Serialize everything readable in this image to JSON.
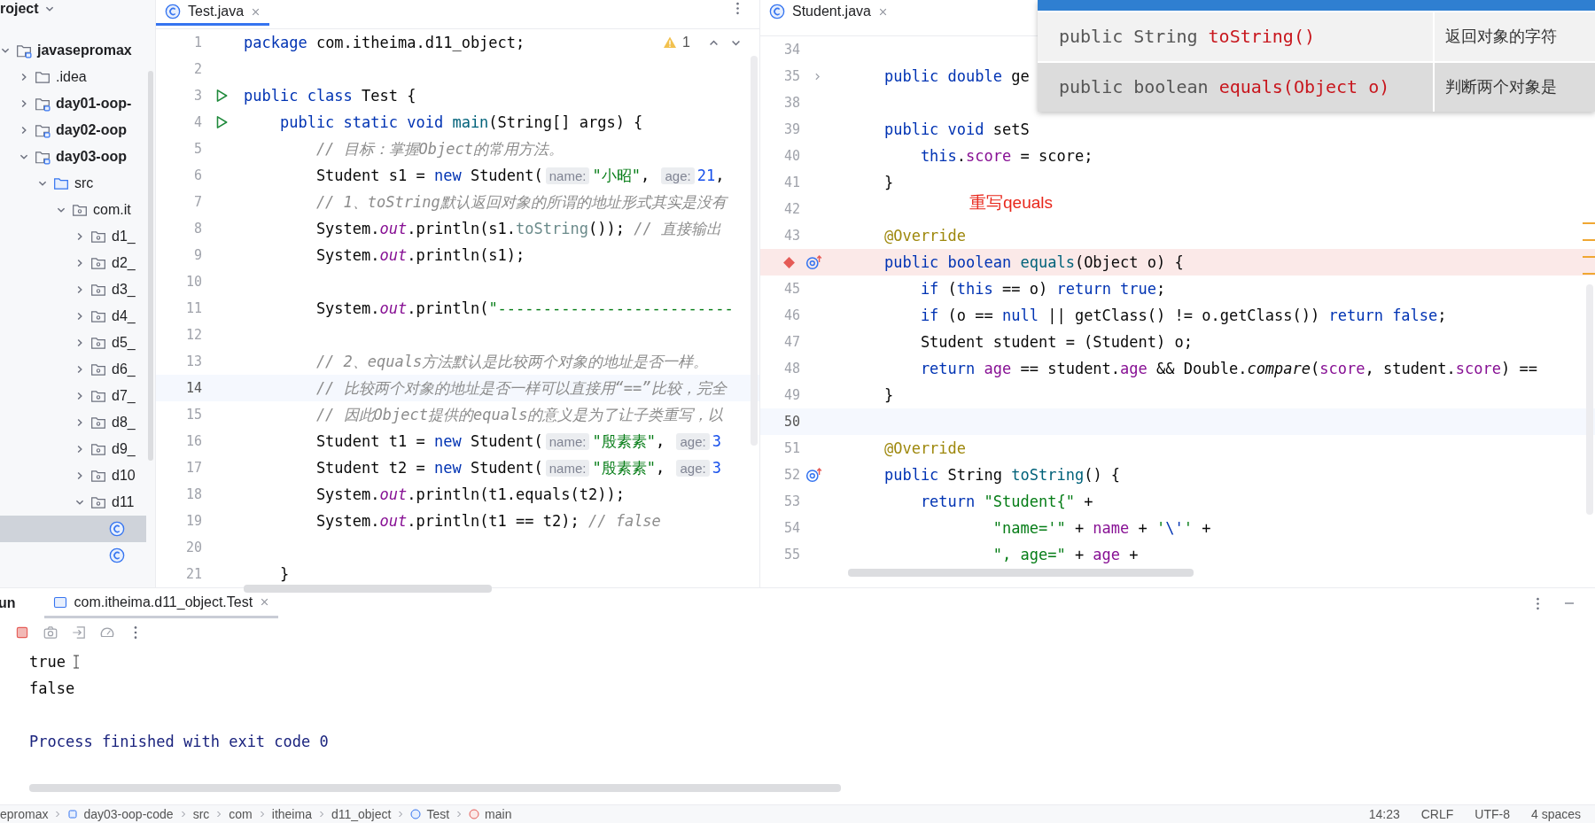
{
  "project_panel": {
    "title": "roject",
    "tree": [
      {
        "label": "javasepromax",
        "kind": "module",
        "expanded": true,
        "selected": false,
        "children": [
          {
            "label": ".idea",
            "kind": "folder",
            "expanded": false,
            "selected": false
          },
          {
            "label": "day01-oop-",
            "kind": "module",
            "expanded": false,
            "selected": false
          },
          {
            "label": "day02-oop",
            "kind": "module",
            "expanded": false,
            "selected": false
          },
          {
            "label": "day03-oop",
            "kind": "module",
            "expanded": true,
            "selected": false,
            "children": [
              {
                "label": "src",
                "kind": "source",
                "expanded": true,
                "selected": false,
                "children": [
                  {
                    "label": "com.it",
                    "kind": "package",
                    "expanded": true,
                    "selected": false,
                    "children": [
                      {
                        "label": "d1_",
                        "kind": "package",
                        "expanded": false,
                        "selected": false
                      },
                      {
                        "label": "d2_",
                        "kind": "package",
                        "expanded": false,
                        "selected": false
                      },
                      {
                        "label": "d3_",
                        "kind": "package",
                        "expanded": false,
                        "selected": false
                      },
                      {
                        "label": "d4_",
                        "kind": "package",
                        "expanded": false,
                        "selected": false
                      },
                      {
                        "label": "d5_",
                        "kind": "package",
                        "expanded": false,
                        "selected": false
                      },
                      {
                        "label": "d6_",
                        "kind": "package",
                        "expanded": false,
                        "selected": false
                      },
                      {
                        "label": "d7_",
                        "kind": "package",
                        "expanded": false,
                        "selected": false
                      },
                      {
                        "label": "d8_",
                        "kind": "package",
                        "expanded": false,
                        "selected": false
                      },
                      {
                        "label": "d9_",
                        "kind": "package",
                        "expanded": false,
                        "selected": false
                      },
                      {
                        "label": "d10",
                        "kind": "package",
                        "expanded": false,
                        "selected": false
                      },
                      {
                        "label": "d11",
                        "kind": "package",
                        "expanded": true,
                        "selected": false,
                        "children": [
                          {
                            "kind": "class",
                            "selected": true
                          },
                          {
                            "kind": "class",
                            "selected": false
                          }
                        ]
                      }
                    ]
                  }
                ]
              }
            ]
          }
        ]
      }
    ]
  },
  "left_editor": {
    "tab": {
      "label": "Test.java",
      "selected": true
    },
    "warnings": "1",
    "lines": [
      {
        "number": "1",
        "current": false,
        "tokens": [
          {
            "kind": "kw",
            "text": "package "
          },
          {
            "kind": "p",
            "text": "com.itheima.d11_object;"
          }
        ]
      },
      {
        "number": "2",
        "current": false
      },
      {
        "number": "3",
        "current": false,
        "gutter": {
          "kind": "run"
        },
        "tokens": [
          {
            "kind": "kw",
            "text": "public class "
          },
          {
            "kind": "p",
            "text": "Test {"
          }
        ]
      },
      {
        "number": "4",
        "current": false,
        "gutter": {
          "kind": "run"
        },
        "tokens": [
          {
            "kind": "kw",
            "text": "    public static void "
          },
          {
            "kind": "fn",
            "text": "main"
          },
          {
            "kind": "p",
            "text": "(String[] args) {"
          }
        ]
      },
      {
        "number": "5",
        "current": false,
        "tokens": [
          {
            "kind": "cmt",
            "text": "        // 目标：掌握Object的常用方法。"
          }
        ]
      },
      {
        "number": "6",
        "current": false,
        "tokens": [
          {
            "kind": "p",
            "text": "        Student s1 = "
          },
          {
            "kind": "kw",
            "text": "new "
          },
          {
            "kind": "p",
            "text": "Student("
          },
          {
            "kind": "hint",
            "text": "name:"
          },
          {
            "kind": "str",
            "text": "\"小昭\""
          },
          {
            "kind": "p",
            "text": ", "
          },
          {
            "kind": "hint",
            "text": "age:"
          },
          {
            "kind": "num",
            "text": "21"
          },
          {
            "kind": "p",
            "text": ","
          }
        ]
      },
      {
        "number": "7",
        "current": false,
        "tokens": [
          {
            "kind": "cmt",
            "text": "        // 1、toString默认返回对象的所谓的地址形式其实是没有"
          }
        ]
      },
      {
        "number": "8",
        "current": false,
        "tokens": [
          {
            "kind": "p",
            "text": "        System."
          },
          {
            "kind": "sfld",
            "text": "out"
          },
          {
            "kind": "p",
            "text": ".println(s1."
          },
          {
            "kind": "dim",
            "text": "toString"
          },
          {
            "kind": "p",
            "text": "()); "
          },
          {
            "kind": "cmt",
            "text": "// 直接输出"
          }
        ]
      },
      {
        "number": "9",
        "current": false,
        "tokens": [
          {
            "kind": "p",
            "text": "        System."
          },
          {
            "kind": "sfld",
            "text": "out"
          },
          {
            "kind": "p",
            "text": ".println(s1);"
          }
        ]
      },
      {
        "number": "10",
        "current": false
      },
      {
        "number": "11",
        "current": false,
        "tokens": [
          {
            "kind": "p",
            "text": "        System."
          },
          {
            "kind": "sfld",
            "text": "out"
          },
          {
            "kind": "p",
            "text": ".println("
          },
          {
            "kind": "str",
            "text": "\"--------------------------"
          }
        ]
      },
      {
        "number": "12",
        "current": false
      },
      {
        "number": "13",
        "current": false,
        "tokens": [
          {
            "kind": "cmt",
            "text": "        // 2、equals方法默认是比较两个对象的地址是否一样。"
          }
        ]
      },
      {
        "number": "14",
        "current": true,
        "tokens": [
          {
            "kind": "cmt",
            "text": "        // 比较两个对象的地址是否一样可以直接用“==”比较，完全"
          }
        ]
      },
      {
        "number": "15",
        "current": false,
        "tokens": [
          {
            "kind": "cmt",
            "text": "        // 因此Object提供的equals的意义是为了让子类重写，以"
          }
        ]
      },
      {
        "number": "16",
        "current": false,
        "tokens": [
          {
            "kind": "p",
            "text": "        Student t1 = "
          },
          {
            "kind": "kw",
            "text": "new "
          },
          {
            "kind": "p",
            "text": "Student("
          },
          {
            "kind": "hint",
            "text": "name:"
          },
          {
            "kind": "str",
            "text": "\"殷素素\""
          },
          {
            "kind": "p",
            "text": ", "
          },
          {
            "kind": "hint",
            "text": "age:"
          },
          {
            "kind": "num",
            "text": "3"
          }
        ]
      },
      {
        "number": "17",
        "current": false,
        "tokens": [
          {
            "kind": "p",
            "text": "        Student t2 = "
          },
          {
            "kind": "kw",
            "text": "new "
          },
          {
            "kind": "p",
            "text": "Student("
          },
          {
            "kind": "hint",
            "text": "name:"
          },
          {
            "kind": "str",
            "text": "\"殷素素\""
          },
          {
            "kind": "p",
            "text": ", "
          },
          {
            "kind": "hint",
            "text": "age:"
          },
          {
            "kind": "num",
            "text": "3"
          }
        ]
      },
      {
        "number": "18",
        "current": false,
        "tokens": [
          {
            "kind": "p",
            "text": "        System."
          },
          {
            "kind": "sfld",
            "text": "out"
          },
          {
            "kind": "p",
            "text": ".println(t1.equals(t2));"
          }
        ]
      },
      {
        "number": "19",
        "current": false,
        "tokens": [
          {
            "kind": "p",
            "text": "        System."
          },
          {
            "kind": "sfld",
            "text": "out"
          },
          {
            "kind": "p",
            "text": ".println(t1 == t2); "
          },
          {
            "kind": "cmt",
            "text": "// false"
          }
        ]
      },
      {
        "number": "20",
        "current": false
      },
      {
        "number": "21",
        "current": false,
        "tokens": [
          {
            "kind": "p",
            "text": "    }"
          }
        ]
      }
    ]
  },
  "right_editor": {
    "tab": {
      "label": "Student.java",
      "selected": false
    },
    "note": "重写qeuals",
    "lines": [
      {
        "number": "34",
        "current": false,
        "breakpoint": false
      },
      {
        "number": "35",
        "current": false,
        "breakpoint": false,
        "gutter": {
          "kind": "fold"
        },
        "tokens": [
          {
            "kind": "kw",
            "text": "    public double "
          },
          {
            "kind": "p",
            "text": "ge"
          }
        ]
      },
      {
        "number": "38",
        "current": false,
        "breakpoint": false
      },
      {
        "number": "39",
        "current": false,
        "breakpoint": false,
        "tokens": [
          {
            "kind": "kw",
            "text": "    public void "
          },
          {
            "kind": "p",
            "text": "setS"
          }
        ]
      },
      {
        "number": "40",
        "current": false,
        "breakpoint": false,
        "tokens": [
          {
            "kind": "kw",
            "text": "        this"
          },
          {
            "kind": "p",
            "text": "."
          },
          {
            "kind": "field",
            "text": "score"
          },
          {
            "kind": "p",
            "text": " = score;"
          }
        ]
      },
      {
        "number": "41",
        "current": false,
        "breakpoint": false,
        "tokens": [
          {
            "kind": "p",
            "text": "    }"
          }
        ]
      },
      {
        "number": "42",
        "current": false,
        "breakpoint": false
      },
      {
        "number": "43",
        "current": false,
        "breakpoint": false,
        "tokens": [
          {
            "kind": "ann",
            "text": "    @Override"
          }
        ]
      },
      {
        "current": false,
        "breakpoint": true,
        "gutter": {
          "kind": "override"
        },
        "tokens": [
          {
            "kind": "kw",
            "text": "    public boolean "
          },
          {
            "kind": "fn",
            "text": "equals"
          },
          {
            "kind": "p",
            "text": "(Object o) {"
          }
        ]
      },
      {
        "number": "45",
        "current": false,
        "breakpoint": false,
        "tokens": [
          {
            "kind": "kw",
            "text": "        if "
          },
          {
            "kind": "p",
            "text": "("
          },
          {
            "kind": "kw",
            "text": "this"
          },
          {
            "kind": "p",
            "text": " == o) "
          },
          {
            "kind": "kw",
            "text": "return true"
          },
          {
            "kind": "p",
            "text": ";"
          }
        ]
      },
      {
        "number": "46",
        "current": false,
        "breakpoint": false,
        "tokens": [
          {
            "kind": "kw",
            "text": "        if "
          },
          {
            "kind": "p",
            "text": "(o == "
          },
          {
            "kind": "kw",
            "text": "null"
          },
          {
            "kind": "p",
            "text": " || getClass() != o.getClass()) "
          },
          {
            "kind": "kw",
            "text": "return false"
          },
          {
            "kind": "p",
            "text": ";"
          }
        ]
      },
      {
        "number": "47",
        "current": false,
        "breakpoint": false,
        "tokens": [
          {
            "kind": "p",
            "text": "        Student student = (Student) o;"
          }
        ]
      },
      {
        "number": "48",
        "current": false,
        "breakpoint": false,
        "tokens": [
          {
            "kind": "kw",
            "text": "        return "
          },
          {
            "kind": "field",
            "text": "age"
          },
          {
            "kind": "p",
            "text": " == student."
          },
          {
            "kind": "field",
            "text": "age"
          },
          {
            "kind": "p",
            "text": " && Double."
          },
          {
            "kind": "ital",
            "text": "compare"
          },
          {
            "kind": "p",
            "text": "("
          },
          {
            "kind": "field",
            "text": "score"
          },
          {
            "kind": "p",
            "text": ", student."
          },
          {
            "kind": "field",
            "text": "score"
          },
          {
            "kind": "p",
            "text": ") =="
          }
        ]
      },
      {
        "number": "49",
        "current": false,
        "breakpoint": false,
        "tokens": [
          {
            "kind": "p",
            "text": "    }"
          }
        ]
      },
      {
        "number": "50",
        "current": true,
        "breakpoint": false
      },
      {
        "number": "51",
        "current": false,
        "breakpoint": false,
        "tokens": [
          {
            "kind": "ann",
            "text": "    @Override"
          }
        ]
      },
      {
        "number": "52",
        "current": false,
        "breakpoint": false,
        "gutter": {
          "kind": "override"
        },
        "tokens": [
          {
            "kind": "kw",
            "text": "    public "
          },
          {
            "kind": "p",
            "text": "String "
          },
          {
            "kind": "fn",
            "text": "toString"
          },
          {
            "kind": "p",
            "text": "() {"
          }
        ]
      },
      {
        "number": "53",
        "current": false,
        "breakpoint": false,
        "tokens": [
          {
            "kind": "kw",
            "text": "        return "
          },
          {
            "kind": "str",
            "text": "\"Student{\""
          },
          {
            "kind": "p",
            "text": " +"
          }
        ]
      },
      {
        "number": "54",
        "current": false,
        "breakpoint": false,
        "tokens": [
          {
            "kind": "str",
            "text": "                \"name='\""
          },
          {
            "kind": "p",
            "text": " + "
          },
          {
            "kind": "field",
            "text": "name"
          },
          {
            "kind": "p",
            "text": " + "
          },
          {
            "kind": "str",
            "text": "'"
          },
          {
            "kind": "kw",
            "text": "\\'"
          },
          {
            "kind": "str",
            "text": "'"
          },
          {
            "kind": "p",
            "text": " +"
          }
        ]
      },
      {
        "number": "55",
        "current": false,
        "breakpoint": false,
        "tokens": [
          {
            "kind": "str",
            "text": "                \", age=\""
          },
          {
            "kind": "p",
            "text": " + "
          },
          {
            "kind": "field",
            "text": "age"
          },
          {
            "kind": "p",
            "text": " +"
          }
        ]
      }
    ]
  },
  "method_table": {
    "rows": [
      {
        "prefix": "public String ",
        "method": "toString()",
        "description": "返回对象的字符",
        "shaded": false
      },
      {
        "prefix": "public boolean ",
        "method": "equals(Object o)",
        "description": "判断两个对象是",
        "shaded": true
      }
    ]
  },
  "run_panel": {
    "title": "un",
    "tab": {
      "label": "com.itheima.d11_object.Test",
      "selected": true
    },
    "output": [
      {
        "text": "true",
        "kind": "stdout"
      },
      {
        "text": "false",
        "kind": "stdout"
      },
      {
        "text": "Process finished with exit code 0",
        "kind": "system"
      }
    ]
  },
  "status_bar": {
    "breadcrumbs": [
      {
        "label": "epromax",
        "kind": "plain"
      },
      {
        "label": "day03-oop-code",
        "kind": "module"
      },
      {
        "label": "src",
        "kind": "plain"
      },
      {
        "label": "com",
        "kind": "plain"
      },
      {
        "label": "itheima",
        "kind": "plain"
      },
      {
        "label": "d11_object",
        "kind": "plain"
      },
      {
        "label": "Test",
        "kind": "class"
      },
      {
        "label": "main",
        "kind": "method"
      }
    ],
    "items": [
      "14:23",
      "CRLF",
      "UTF-8",
      "4 spaces"
    ]
  }
}
